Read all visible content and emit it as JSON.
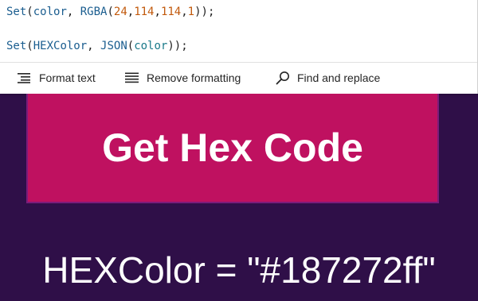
{
  "editor": {
    "line1": {
      "fn": "Set",
      "open": "(",
      "arg1": "color",
      "sep": ", ",
      "inner_fn": "RGBA",
      "inner_open": "(",
      "r": "24",
      "c1": ",",
      "g": "114",
      "c2": ",",
      "b": "114",
      "c3": ",",
      "a": "1",
      "close": "));"
    },
    "line2": {
      "fn": "Set",
      "open": "(",
      "arg1": "HEXColor",
      "sep": ", ",
      "inner_fn": "JSON",
      "inner_open": "(",
      "arg2": "color",
      "close": "));"
    }
  },
  "toolbar": {
    "format_text_label": "Format text",
    "remove_formatting_label": "Remove formatting",
    "find_replace_label": "Find and replace"
  },
  "canvas": {
    "button_label": "Get Hex Code",
    "result_label": "HEXColor = \"#187272ff\""
  },
  "colors": {
    "background": "#2f0f48",
    "button_fill": "#bf1160",
    "button_border": "#7b1c7a",
    "text": "#ffffff"
  }
}
